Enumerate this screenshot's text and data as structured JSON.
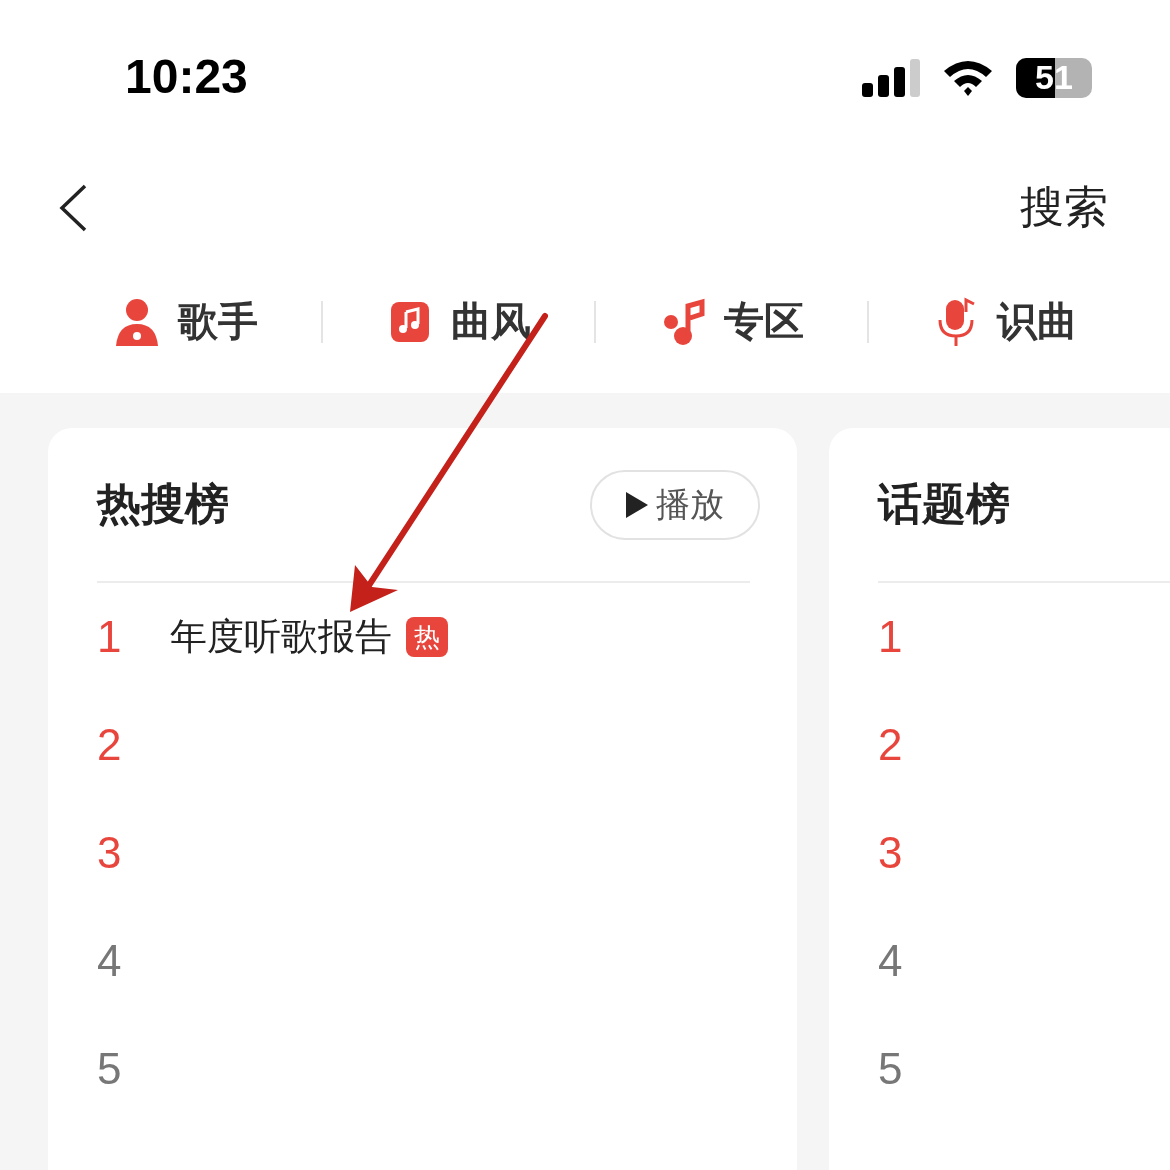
{
  "status_bar": {
    "time": "10:23",
    "battery": "51"
  },
  "nav": {
    "action": "搜索"
  },
  "categories": [
    {
      "label": "歌手",
      "kind": "singer"
    },
    {
      "label": "曲风",
      "kind": "style"
    },
    {
      "label": "专区",
      "kind": "zone"
    },
    {
      "label": "识曲",
      "kind": "recognize"
    }
  ],
  "boards": [
    {
      "title": "热搜榜",
      "play_button": "播放",
      "items": [
        {
          "rank": "1",
          "top": true,
          "title": "年度听歌报告",
          "badge": "热"
        },
        {
          "rank": "2",
          "top": true
        },
        {
          "rank": "3",
          "top": true
        },
        {
          "rank": "4",
          "top": false
        },
        {
          "rank": "5",
          "top": false
        }
      ]
    },
    {
      "title": "话题榜",
      "items": [
        {
          "rank": "1",
          "top": true
        },
        {
          "rank": "2",
          "top": true
        },
        {
          "rank": "3",
          "top": true
        },
        {
          "rank": "4",
          "top": false
        },
        {
          "rank": "5",
          "top": false
        }
      ]
    }
  ]
}
